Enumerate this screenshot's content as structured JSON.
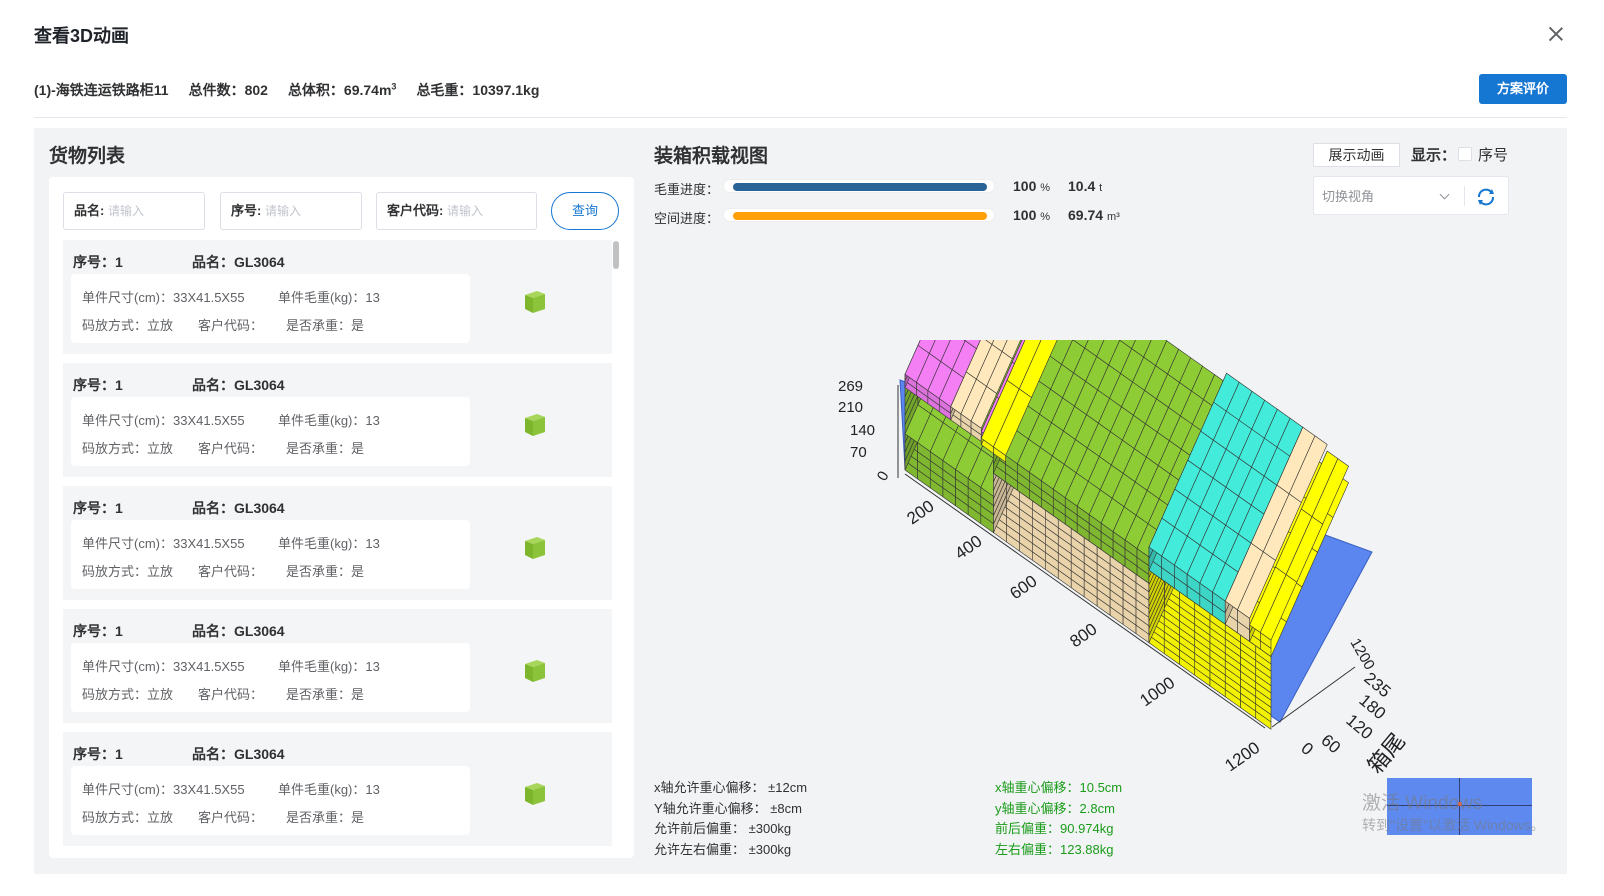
{
  "dialog": {
    "title": "查看3D动画",
    "close_label": "×"
  },
  "summary": {
    "plan": "(1)-海铁连运铁路柜11",
    "count": "总件数：802",
    "volume": "总体积：69.74m",
    "volume_sup": "3",
    "weight": "总毛重：10397.1kg"
  },
  "eval_button": "方案评价",
  "cargo_list": {
    "title": "货物列表",
    "search": [
      {
        "label": "品名:",
        "placeholder": "请输入"
      },
      {
        "label": "序号:",
        "placeholder": "请输入"
      },
      {
        "label": "客户代码:",
        "placeholder": "请输入"
      }
    ],
    "query_button": "查询",
    "items": [
      {
        "seq": "序号：1",
        "name": "品名：GL3064",
        "size": "单件尺寸(cm)：33X41.5X55",
        "weight": "单件毛重(kg)：13",
        "placement": "码放方式：立放",
        "customer": "客户代码：",
        "load_bearing": "是否承重：是"
      },
      {
        "seq": "序号：1",
        "name": "品名：GL3064",
        "size": "单件尺寸(cm)：33X41.5X55",
        "weight": "单件毛重(kg)：13",
        "placement": "码放方式：立放",
        "customer": "客户代码：",
        "load_bearing": "是否承重：是"
      },
      {
        "seq": "序号：1",
        "name": "品名：GL3064",
        "size": "单件尺寸(cm)：33X41.5X55",
        "weight": "单件毛重(kg)：13",
        "placement": "码放方式：立放",
        "customer": "客户代码：",
        "load_bearing": "是否承重：是"
      },
      {
        "seq": "序号：1",
        "name": "品名：GL3064",
        "size": "单件尺寸(cm)：33X41.5X55",
        "weight": "单件毛重(kg)：13",
        "placement": "码放方式：立放",
        "customer": "客户代码：",
        "load_bearing": "是否承重：是"
      },
      {
        "seq": "序号：1",
        "name": "品名：GL3064",
        "size": "单件尺寸(cm)：33X41.5X55",
        "weight": "单件毛重(kg)：13",
        "placement": "码放方式：立放",
        "customer": "客户代码：",
        "load_bearing": "是否承重：是"
      }
    ]
  },
  "loading_view": {
    "title": "装箱积载视图",
    "weight_progress": {
      "label": "毛重进度：",
      "percent": 100,
      "percent_text": "100",
      "unit": "%",
      "value": "10.4",
      "value_unit": "t",
      "color": "#2a6496"
    },
    "space_progress": {
      "label": "空间进度：",
      "percent": 100,
      "percent_text": "100",
      "unit": "%",
      "value": "69.74",
      "value_unit": "m³",
      "color": "#ff9f0a"
    },
    "show_animation": "展示动画",
    "display_label": "显示：",
    "seq_checkbox": {
      "label": "序号",
      "checked": false
    },
    "view_select": "切换视角",
    "axes": {
      "z_ticks": [
        "269",
        "210",
        "140",
        "70",
        "0"
      ],
      "x_ticks": [
        "200",
        "400",
        "600",
        "800",
        "1000",
        "1200"
      ],
      "x_end_tick": "1200",
      "y_ticks": [
        "235",
        "180",
        "120",
        "60",
        "0"
      ],
      "tail_label": "箱尾"
    },
    "limits": [
      "x轴允许重心偏移：  ±12cm",
      "Y轴允许重心偏移：  ±8cm",
      "允许前后偏重：  ±300kg",
      "允许左右偏重：  ±300kg"
    ],
    "actuals": [
      "x轴重心偏移：10.5cm",
      "y轴重心偏移：2.8cm",
      "前后偏重：90.974kg",
      "左右偏重：123.88kg"
    ],
    "colors": {
      "green": "#86c232",
      "tan": "#f5deb3",
      "pink": "#e878e8",
      "yellow": "#ffff00",
      "cyan": "#40e0d0",
      "container": "#5b86f0"
    }
  },
  "watermark": {
    "line1": "激活 Windows",
    "line2": "转到\"设置\"以激活 Windows。"
  }
}
